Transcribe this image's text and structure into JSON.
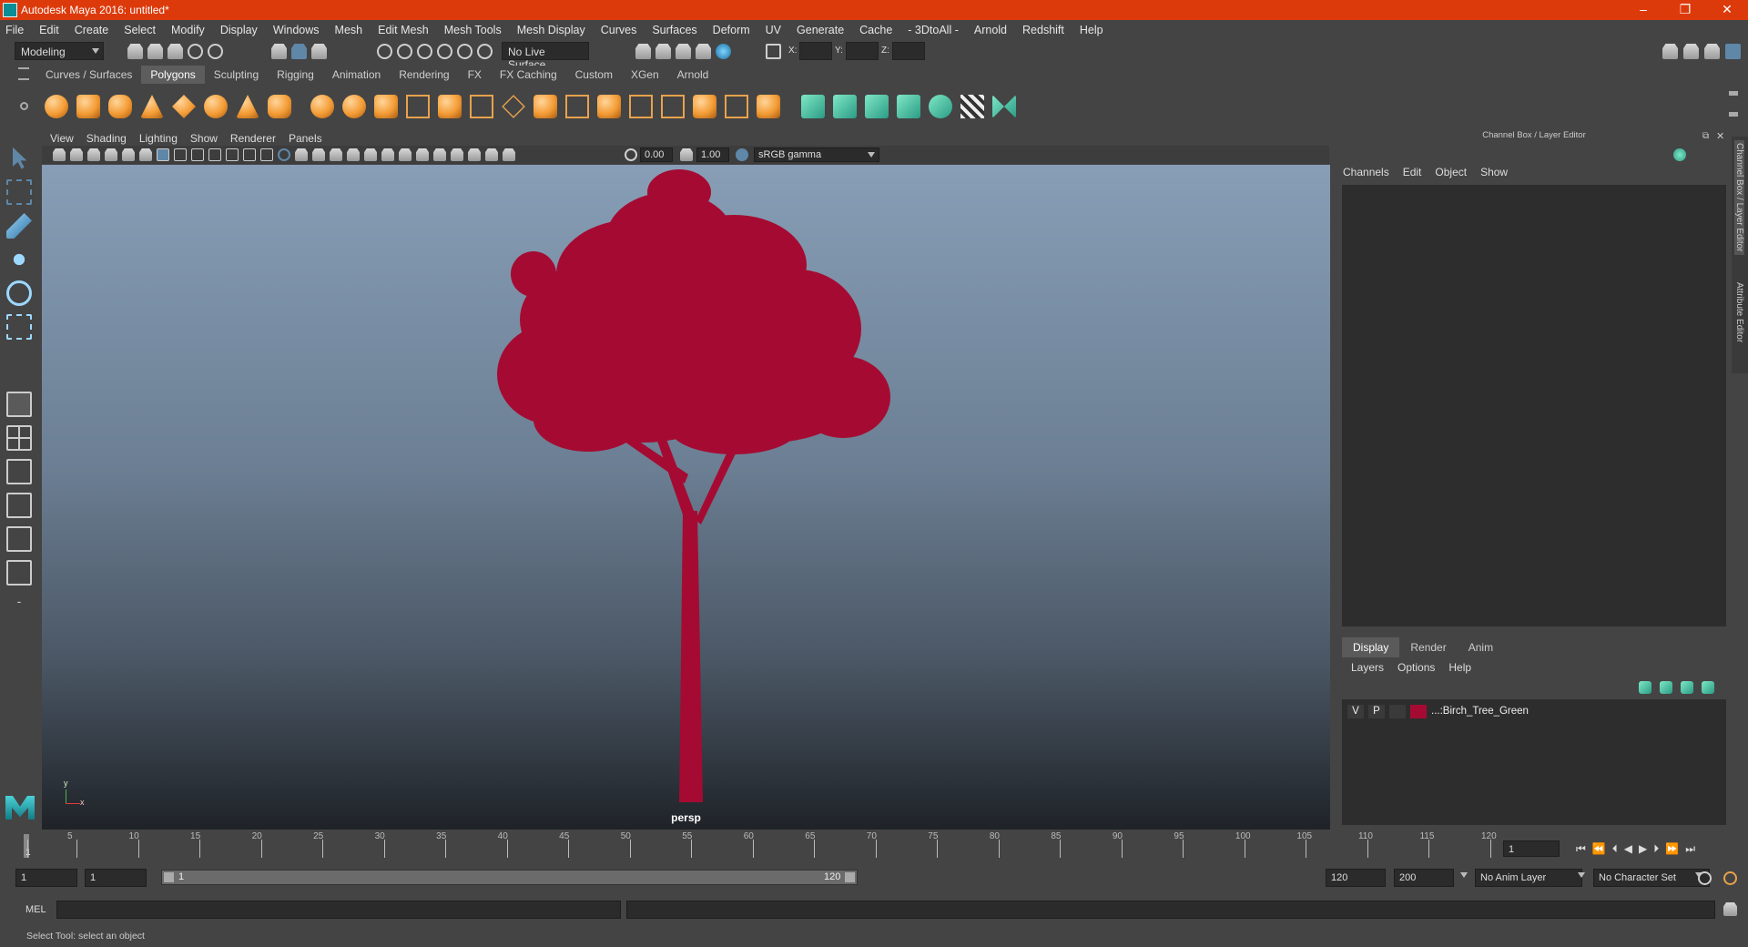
{
  "window": {
    "title": "Autodesk Maya 2016: untitled*",
    "buttons": {
      "minimize": "–",
      "maximize": "❐",
      "close": "✕"
    }
  },
  "menubar": [
    "File",
    "Edit",
    "Create",
    "Select",
    "Modify",
    "Display",
    "Windows",
    "Mesh",
    "Edit Mesh",
    "Mesh Tools",
    "Mesh Display",
    "Curves",
    "Surfaces",
    "Deform",
    "UV",
    "Generate",
    "Cache",
    "- 3DtoAll -",
    "Arnold",
    "Redshift",
    "Help"
  ],
  "statusline": {
    "mode": "Modeling",
    "live_surface": "No Live Surface",
    "x_label": "X:",
    "y_label": "Y:",
    "z_label": "Z:"
  },
  "shelf": {
    "tabs": [
      "Curves / Surfaces",
      "Polygons",
      "Sculpting",
      "Rigging",
      "Animation",
      "Rendering",
      "FX",
      "FX Caching",
      "Custom",
      "XGen",
      "Arnold"
    ],
    "active_tab": "Polygons"
  },
  "viewport": {
    "menus": [
      "View",
      "Shading",
      "Lighting",
      "Show",
      "Renderer",
      "Panels"
    ],
    "exposure": "0.00",
    "gamma": "1.00",
    "color_space": "sRGB gamma",
    "camera_label": "persp",
    "axis_y": "y",
    "axis_x": "x",
    "object_color": "#a50b32"
  },
  "channel_box": {
    "header": "Channel Box / Layer Editor",
    "menus": [
      "Channels",
      "Edit",
      "Object",
      "Show"
    ]
  },
  "layer_editor": {
    "tabs": [
      "Display",
      "Render",
      "Anim"
    ],
    "active_tab": "Display",
    "menus": [
      "Layers",
      "Options",
      "Help"
    ],
    "layers": [
      {
        "v": "V",
        "p": "P",
        "color": "#a50b32",
        "name": "...:Birch_Tree_Green"
      }
    ]
  },
  "side_tabs": [
    "Channel Box / Layer Editor",
    "Attribute Editor"
  ],
  "timeline": {
    "ticks": [
      "1",
      "5",
      "10",
      "15",
      "20",
      "25",
      "30",
      "35",
      "40",
      "45",
      "50",
      "55",
      "60",
      "65",
      "70",
      "75",
      "80",
      "85",
      "90",
      "95",
      "100",
      "105",
      "110",
      "115",
      "120"
    ],
    "current_frame": "1"
  },
  "range": {
    "start": "1",
    "playback_start": "1",
    "slider_start": "1",
    "slider_end": "120",
    "playback_end": "120",
    "end": "200",
    "anim_layer": "No Anim Layer",
    "character_set": "No Character Set"
  },
  "command_line": {
    "label": "MEL"
  },
  "status": {
    "help_line": "Select Tool: select an object"
  }
}
